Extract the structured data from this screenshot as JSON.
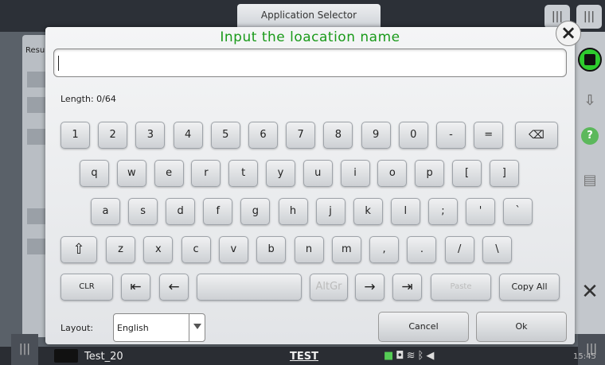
{
  "background": {
    "app_selector_tab": "Application Selector",
    "left_panel_label": "Resu",
    "bottom_left_text": "Test_20",
    "bottom_center_text": "TEST",
    "time": "15:45"
  },
  "dialog": {
    "title": "Input  the loacation name",
    "input_value": "",
    "length_label": "Length: 0/64",
    "layout_label": "Layout:",
    "layout_value": "English",
    "cancel_label": "Cancel",
    "ok_label": "Ok"
  },
  "keyboard": {
    "row1": [
      "1",
      "2",
      "3",
      "4",
      "5",
      "6",
      "7",
      "8",
      "9",
      "0",
      "-",
      "="
    ],
    "row2": [
      "q",
      "w",
      "e",
      "r",
      "t",
      "y",
      "u",
      "i",
      "o",
      "p",
      "[",
      "]"
    ],
    "row3": [
      "a",
      "s",
      "d",
      "f",
      "g",
      "h",
      "j",
      "k",
      "l",
      ";",
      "'",
      "`"
    ],
    "row4": [
      "z",
      "x",
      "c",
      "v",
      "b",
      "n",
      "m",
      ",",
      ".",
      "/",
      "\\"
    ],
    "clr": "CLR",
    "home_arrow": "⇤",
    "left_arrow": "←",
    "altgr": "AltGr",
    "right_arrow": "→",
    "end_arrow": "⇥",
    "paste": "Paste",
    "copy_all": "Copy All",
    "backspace": "⌫",
    "shift": "⇧"
  },
  "colors": {
    "title_green": "#1a9a1a",
    "record_green": "#2ecc2e"
  }
}
